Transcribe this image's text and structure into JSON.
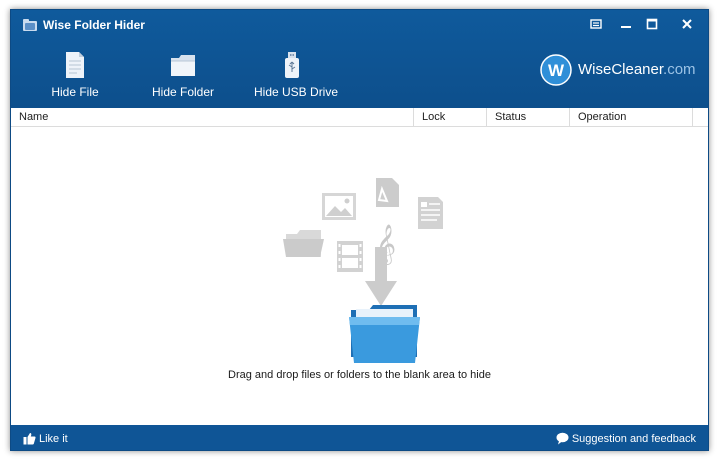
{
  "window": {
    "title": "Wise Folder Hider",
    "controls": [
      "menu",
      "minimize",
      "maximize",
      "close"
    ]
  },
  "toolbar": {
    "hide_file": "Hide File",
    "hide_folder": "Hide Folder",
    "hide_usb": "Hide USB Drive"
  },
  "brand": {
    "logo_letter": "W",
    "name": "WiseCleaner",
    "domain": ".com"
  },
  "table": {
    "columns": [
      "Name",
      "Lock",
      "Status",
      "Operation"
    ],
    "rows": []
  },
  "drop_area": {
    "hint": "Drag and drop files or folders to the blank area to hide"
  },
  "statusbar": {
    "like": "Like it",
    "feedback": "Suggestion and feedback"
  },
  "colors": {
    "header_blue": "#0f5596",
    "brand_circle": "#2f8fd8",
    "folder_blue": "#3a9ade"
  }
}
